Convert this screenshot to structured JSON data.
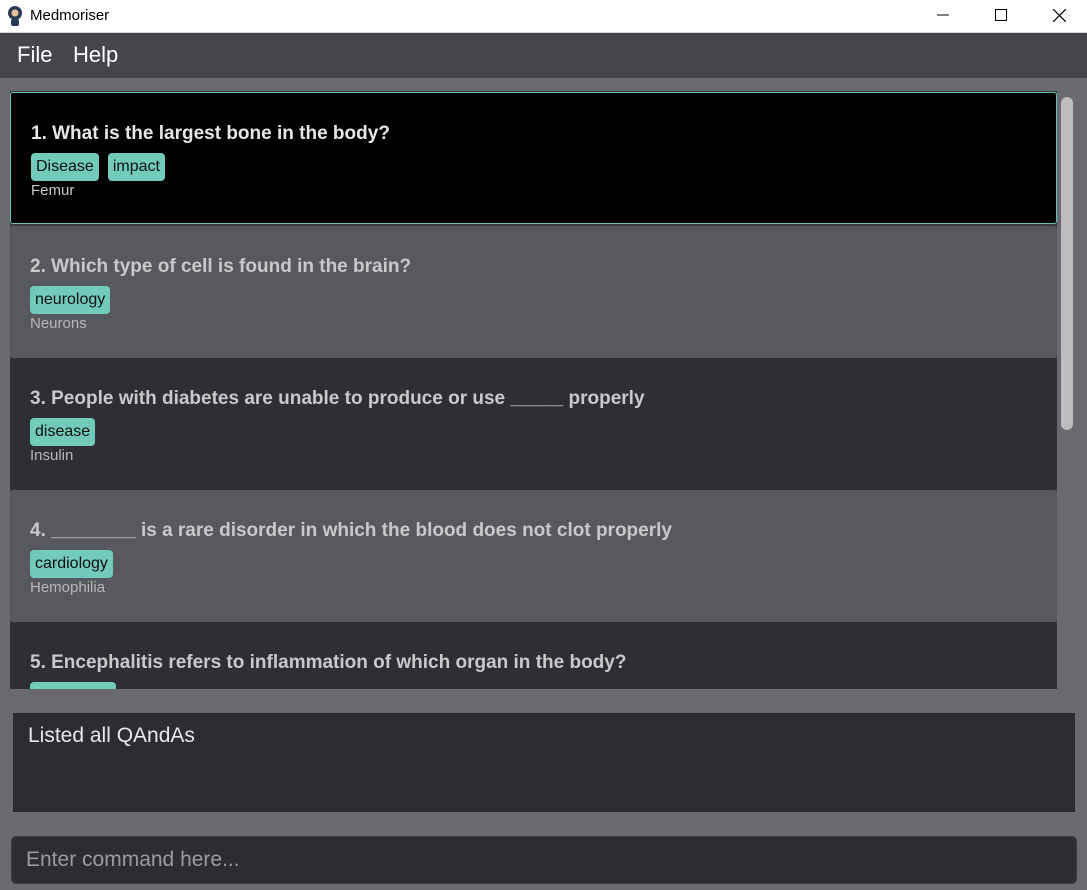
{
  "window": {
    "title": "Medmoriser"
  },
  "menu": {
    "file": "File",
    "help": "Help"
  },
  "cards": [
    {
      "question": "1.  What is the largest bone in the body?",
      "tags": [
        "Disease",
        "impact"
      ],
      "answer": "Femur",
      "state": "selected"
    },
    {
      "question": "2.  Which type of cell is found in the brain?",
      "tags": [
        "neurology"
      ],
      "answer": "Neurons",
      "state": "light"
    },
    {
      "question": "3.  People with diabetes are unable to produce or use _____ properly",
      "tags": [
        "disease"
      ],
      "answer": "Insulin",
      "state": "dark"
    },
    {
      "question": "4.  ________ is a rare disorder in which the blood does not clot properly",
      "tags": [
        "cardiology"
      ],
      "answer": "Hemophilia",
      "state": "light"
    },
    {
      "question": "5.  Encephalitis refers to inflammation of which organ in the body?",
      "tags": [],
      "answer": "",
      "state": "dark"
    }
  ],
  "result": {
    "text": "Listed all QAndAs"
  },
  "command": {
    "placeholder": "Enter command here...",
    "value": ""
  },
  "colors": {
    "accent": "#72cabb",
    "selected_border": "#5fc3b4",
    "menubar": "#45464b",
    "background": "#6a6a6e"
  }
}
